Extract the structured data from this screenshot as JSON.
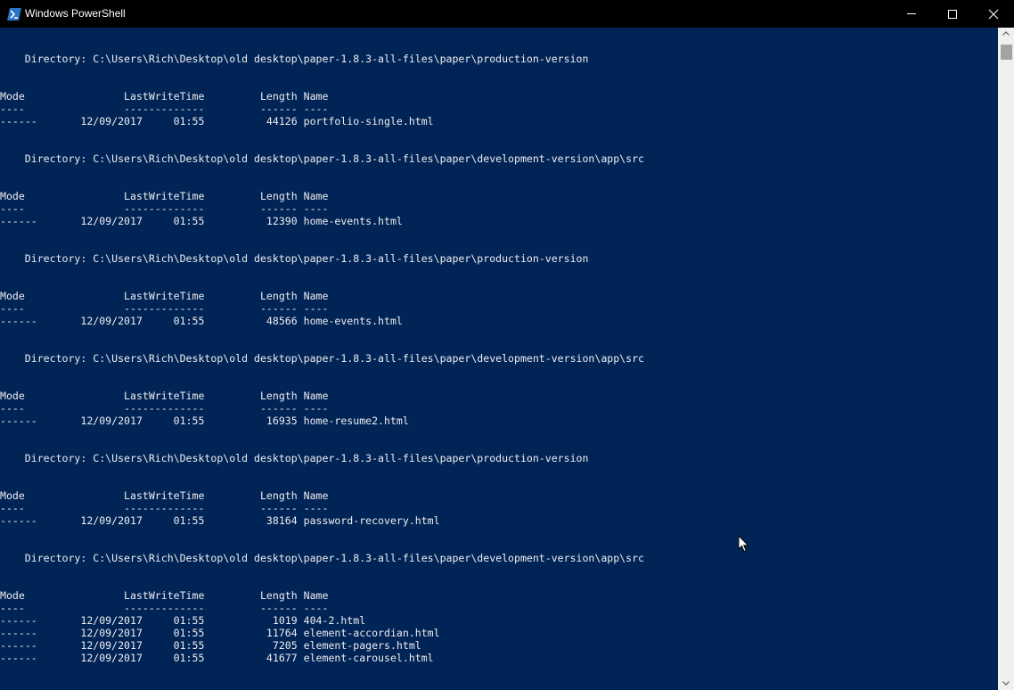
{
  "window": {
    "title": "Windows PowerShell",
    "icon": "powershell-icon",
    "controls": [
      "minimize-icon",
      "maximize-icon",
      "close-icon"
    ]
  },
  "colors": {
    "background": "#012456",
    "text": "#eeedf0",
    "titlebar": "#000000"
  },
  "console": {
    "lines": [
      "    Directory: C:\\Users\\Rich\\Desktop\\old desktop\\paper-1.8.3-all-files\\paper\\production-version",
      "Mode                LastWriteTime         Length Name",
      "----                -------------         ------ ----",
      "------       12/09/2017     01:55          44126 portfolio-single.html",
      "    Directory: C:\\Users\\Rich\\Desktop\\old desktop\\paper-1.8.3-all-files\\paper\\development-version\\app\\src",
      "Mode                LastWriteTime         Length Name",
      "----                -------------         ------ ----",
      "------       12/09/2017     01:55          12390 home-events.html",
      "    Directory: C:\\Users\\Rich\\Desktop\\old desktop\\paper-1.8.3-all-files\\paper\\production-version",
      "Mode                LastWriteTime         Length Name",
      "----                -------------         ------ ----",
      "------       12/09/2017     01:55          48566 home-events.html",
      "    Directory: C:\\Users\\Rich\\Desktop\\old desktop\\paper-1.8.3-all-files\\paper\\development-version\\app\\src",
      "Mode                LastWriteTime         Length Name",
      "----                -------------         ------ ----",
      "------       12/09/2017     01:55          16935 home-resume2.html",
      "    Directory: C:\\Users\\Rich\\Desktop\\old desktop\\paper-1.8.3-all-files\\paper\\production-version",
      "Mode                LastWriteTime         Length Name",
      "----                -------------         ------ ----",
      "------       12/09/2017     01:55          38164 password-recovery.html",
      "    Directory: C:\\Users\\Rich\\Desktop\\old desktop\\paper-1.8.3-all-files\\paper\\development-version\\app\\src",
      "Mode                LastWriteTime         Length Name",
      "----                -------------         ------ ----",
      "------       12/09/2017     01:55           1019 404-2.html",
      "------       12/09/2017     01:55          11764 element-accordian.html",
      "------       12/09/2017     01:55           7205 element-pagers.html",
      "------       12/09/2017     01:55          41677 element-carousel.html"
    ]
  },
  "scrollbar": {
    "up_icon": "scroll-up-arrow-icon",
    "down_icon": "scroll-down-arrow-icon"
  },
  "cursor": "mouse-pointer-icon"
}
